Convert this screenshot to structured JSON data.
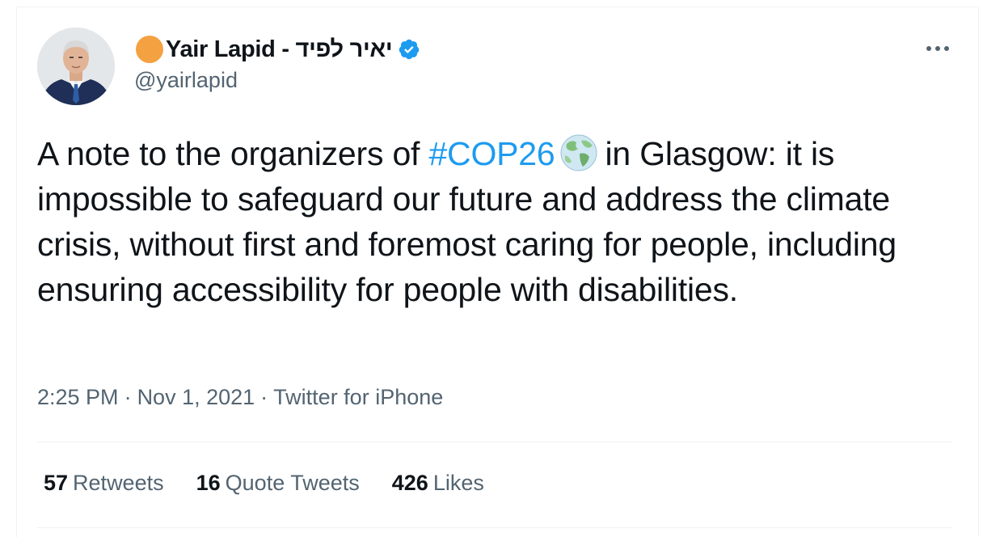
{
  "author": {
    "display_name": "Yair Lapid - יאיר לפיד",
    "handle": "@yairlapid",
    "verified_icon": "verified-badge-icon",
    "avatar_icon": "avatar-photo",
    "status_dot_color": "#f4a142"
  },
  "tweet": {
    "text_before_hashtag": "A note to the organizers of ",
    "hashtag": "#COP26",
    "hashtag_emoji": "globe-emoji-icon",
    "text_after_hashtag": "in Glasgow: it is impossible to safeguard our future and address the climate crisis, without first and foremost caring for people, including ensuring accessibility for people with disabilities."
  },
  "meta": {
    "time": "2:25 PM",
    "separator": "·",
    "date": "Nov 1, 2021",
    "source": "Twitter for iPhone"
  },
  "stats": {
    "retweets_count": "57",
    "retweets_label": "Retweets",
    "quotes_count": "16",
    "quotes_label": "Quote Tweets",
    "likes_count": "426",
    "likes_label": "Likes"
  },
  "colors": {
    "accent": "#1d9bf0",
    "text": "#0f1419",
    "secondary": "#536471"
  }
}
